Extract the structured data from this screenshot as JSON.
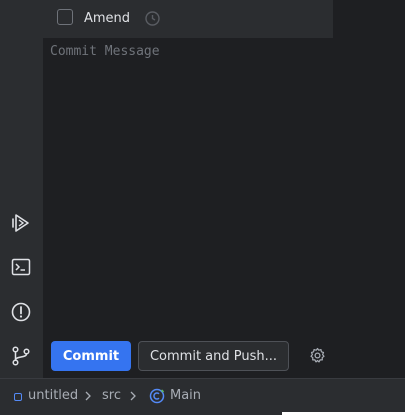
{
  "commit_panel": {
    "amend_label": "Amend",
    "amend_checked": false,
    "message_placeholder": "Commit Message",
    "commit_button": "Commit",
    "commit_push_button": "Commit and Push..."
  },
  "left_strip": {
    "icons": [
      "run-icon",
      "terminal-icon",
      "problems-icon",
      "git-icon"
    ]
  },
  "status_bar": {
    "breadcrumbs": [
      "untitled",
      "src",
      "Main"
    ]
  },
  "colors": {
    "accent": "#3574f0",
    "background": "#1e1f22",
    "panel": "#2b2d30",
    "text": "#dfe1e5",
    "muted": "#6f737a"
  }
}
